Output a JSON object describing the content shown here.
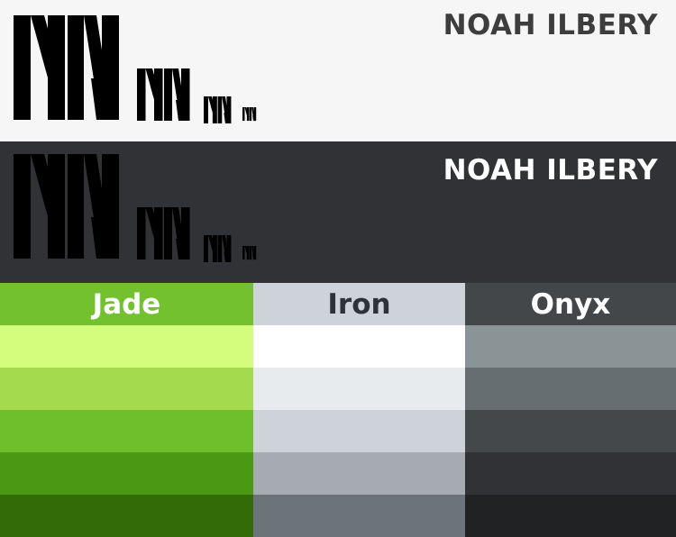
{
  "header_light": {
    "title": "NOAH ILBERY",
    "background": "#f6f6f6",
    "logo_colors": {
      "base": "#3d3d3d",
      "accent": "#74c12f"
    }
  },
  "header_dark": {
    "title": "NOAH ILBERY",
    "background": "#303235",
    "logo_colors": {
      "base": "#ffffff",
      "accent": "#74c12f"
    }
  },
  "palette": [
    {
      "name": "Jade",
      "head_color": "#74c12f",
      "text_color": "#ffffff",
      "swatches": [
        "#d4fd7d",
        "#a4db4e",
        "#6fbf2d",
        "#4a9813",
        "#326b08"
      ]
    },
    {
      "name": "Iron",
      "head_color": "#ced3da",
      "text_color": "#2f3236",
      "swatches": [
        "#ffffff",
        "#e7ebee",
        "#ced3da",
        "#a5abb1",
        "#6c7379"
      ]
    },
    {
      "name": "Onyx",
      "head_color": "#44474a",
      "text_color": "#ffffff",
      "swatches": [
        "#8a9396",
        "#676e72",
        "#45484b",
        "#303235",
        "#212223"
      ]
    }
  ]
}
